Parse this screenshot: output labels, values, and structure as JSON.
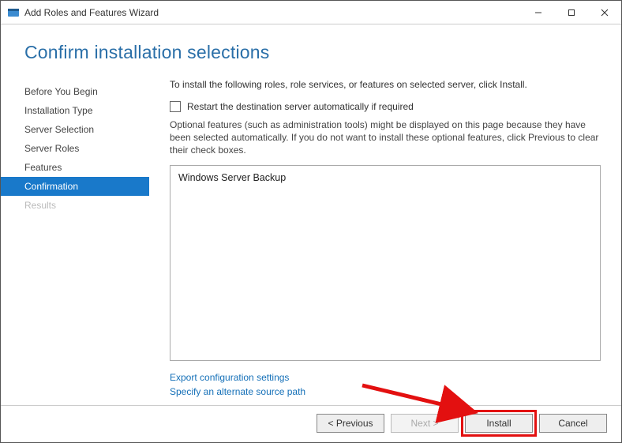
{
  "window": {
    "title": "Add Roles and Features Wizard"
  },
  "heading": "Confirm installation selections",
  "sidebar": {
    "items": [
      {
        "label": "Before You Begin",
        "state": "normal"
      },
      {
        "label": "Installation Type",
        "state": "normal"
      },
      {
        "label": "Server Selection",
        "state": "normal"
      },
      {
        "label": "Server Roles",
        "state": "normal"
      },
      {
        "label": "Features",
        "state": "normal"
      },
      {
        "label": "Confirmation",
        "state": "selected"
      },
      {
        "label": "Results",
        "state": "disabled"
      }
    ]
  },
  "content": {
    "intro": "To install the following roles, role services, or features on selected server, click Install.",
    "restart_checkbox_label": "Restart the destination server automatically if required",
    "restart_checkbox_checked": false,
    "note": "Optional features (such as administration tools) might be displayed on this page because they have been selected automatically. If you do not want to install these optional features, click Previous to clear their check boxes.",
    "features_list": [
      "Windows Server Backup"
    ],
    "links": {
      "export": "Export configuration settings",
      "alt_source": "Specify an alternate source path"
    }
  },
  "footer": {
    "previous": "< Previous",
    "next": "Next >",
    "install": "Install",
    "cancel": "Cancel",
    "next_enabled": false
  }
}
